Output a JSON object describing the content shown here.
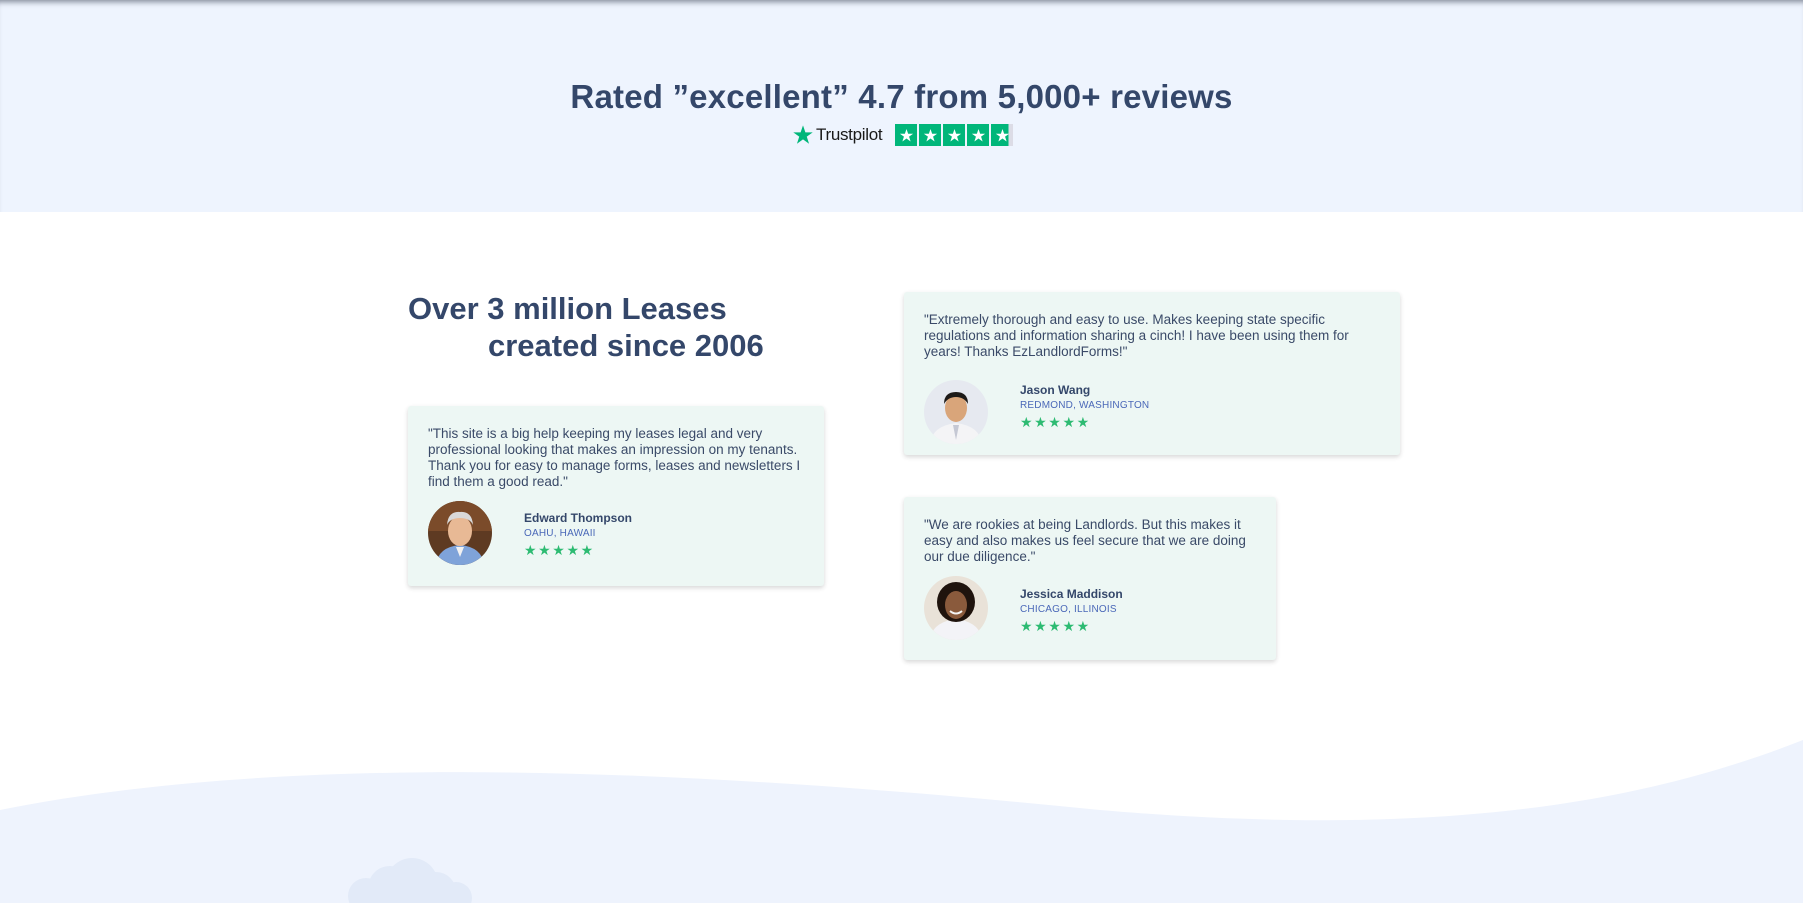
{
  "rating": {
    "prefix": "Rated ",
    "emphasis": "”excellent”",
    "suffix": " 4.7 from 5,000+ reviews",
    "trustpilot_label": "Trustpilot",
    "stars": 4.7
  },
  "headline": {
    "line1": "Over 3 million Leases",
    "line2": "created since 2006"
  },
  "testimonials": [
    {
      "quote": "\"This site is a big help keeping my leases legal and very professional looking that makes an impression on my tenants. Thank you for easy to manage forms, leases and newsletters I find them a good read.\"",
      "name": "Edward Thompson",
      "location": "OAHU, HAWAII",
      "stars": "★★★★★"
    },
    {
      "quote": "\"Extremely thorough and easy to use. Makes keeping state specific regulations and information sharing a cinch! I have been using them for years! Thanks EzLandlordForms!\"",
      "name": "Jason Wang",
      "location": "REDMOND, WASHINGTON",
      "stars": "★★★★★"
    },
    {
      "quote": "\"We are rookies at being Landlords. But this makes it easy and also makes us feel secure that we are doing our due diligence.\"",
      "name": "Jessica Maddison",
      "location": "CHICAGO, ILLINOIS",
      "stars": "★★★★★"
    }
  ],
  "colors": {
    "band": "#eef4fe",
    "text": "#34476a",
    "card": "#edf7f4",
    "trustpilot_green": "#00b67a",
    "star_green": "#2dbb72",
    "location": "#4a68b8"
  }
}
